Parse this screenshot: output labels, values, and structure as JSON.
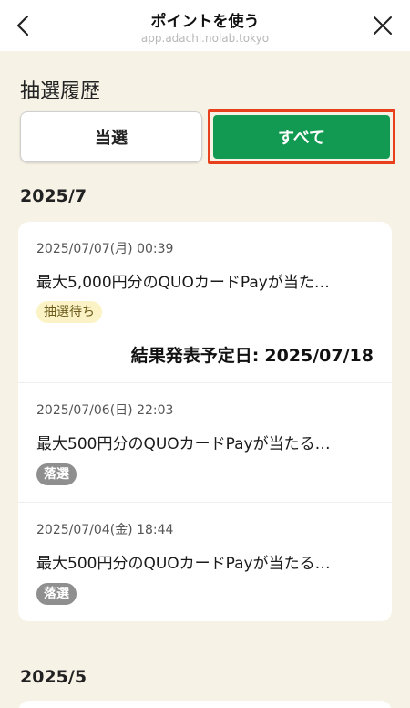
{
  "header": {
    "title": "ポイントを使う",
    "url": "app.adachi.nolab.tokyo"
  },
  "section_title": "抽選履歴",
  "filters": {
    "win_label": "当選",
    "all_label": "すべて"
  },
  "months": [
    {
      "label": "2025/7",
      "entries": [
        {
          "date": "2025/07/07(月) 00:39",
          "title": "最大5,000円分のQUOカードPayが当た…",
          "status": "抽選待ち",
          "result_label": "結果発表予定日:",
          "result_date": "2025/07/18"
        },
        {
          "date": "2025/07/06(日) 22:03",
          "title": "最大500円分のQUOカードPayが当たる…",
          "status": "落選"
        },
        {
          "date": "2025/07/04(金) 18:44",
          "title": "最大500円分のQUOカードPayが当たる…",
          "status": "落選"
        }
      ]
    },
    {
      "label": "2025/5"
    }
  ],
  "colors": {
    "accent_green": "#139a52",
    "highlight_red": "#e8401c",
    "background_beige": "#f6f2e6",
    "pending_badge": "#fbf3c5",
    "lost_badge": "#8f8f8f"
  }
}
